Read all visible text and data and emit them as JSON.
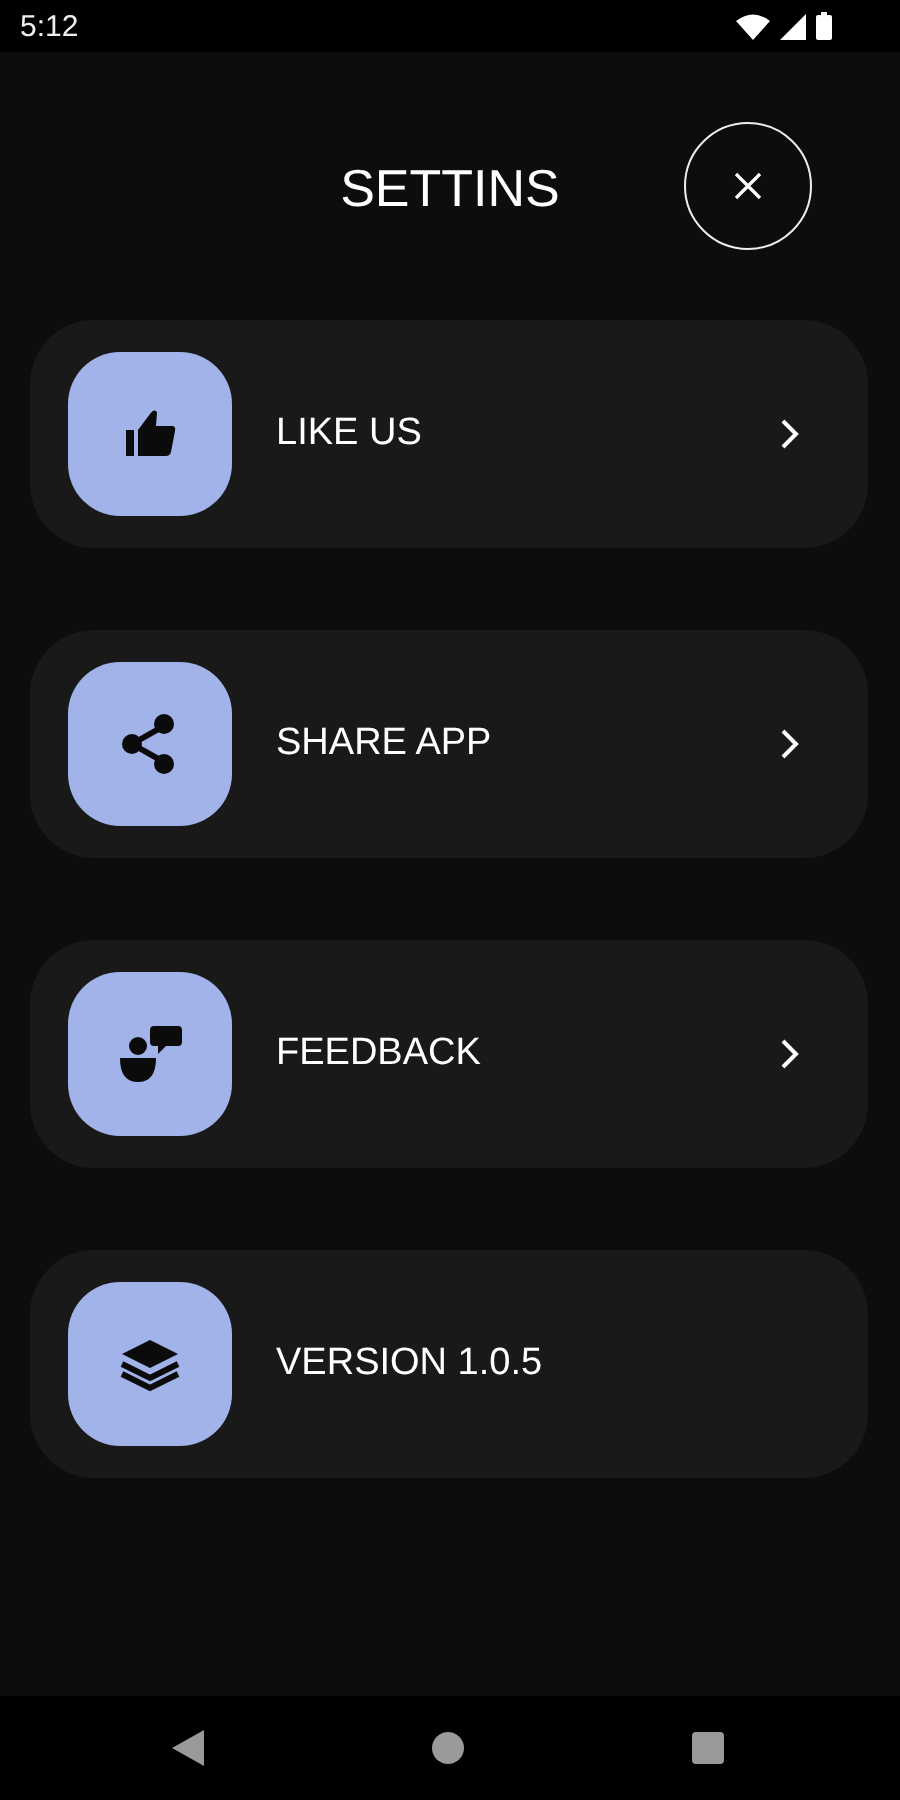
{
  "status_bar": {
    "time": "5:12"
  },
  "header": {
    "title": "SETTINS"
  },
  "items": [
    {
      "kind": "thumb",
      "label": "LIKE US",
      "chevron": true
    },
    {
      "kind": "share",
      "label": "SHARE APP",
      "chevron": true
    },
    {
      "kind": "feedback",
      "label": "FEEDBACK",
      "chevron": true
    },
    {
      "kind": "layers",
      "label": "VERSION 1.0.5",
      "chevron": false
    }
  ]
}
